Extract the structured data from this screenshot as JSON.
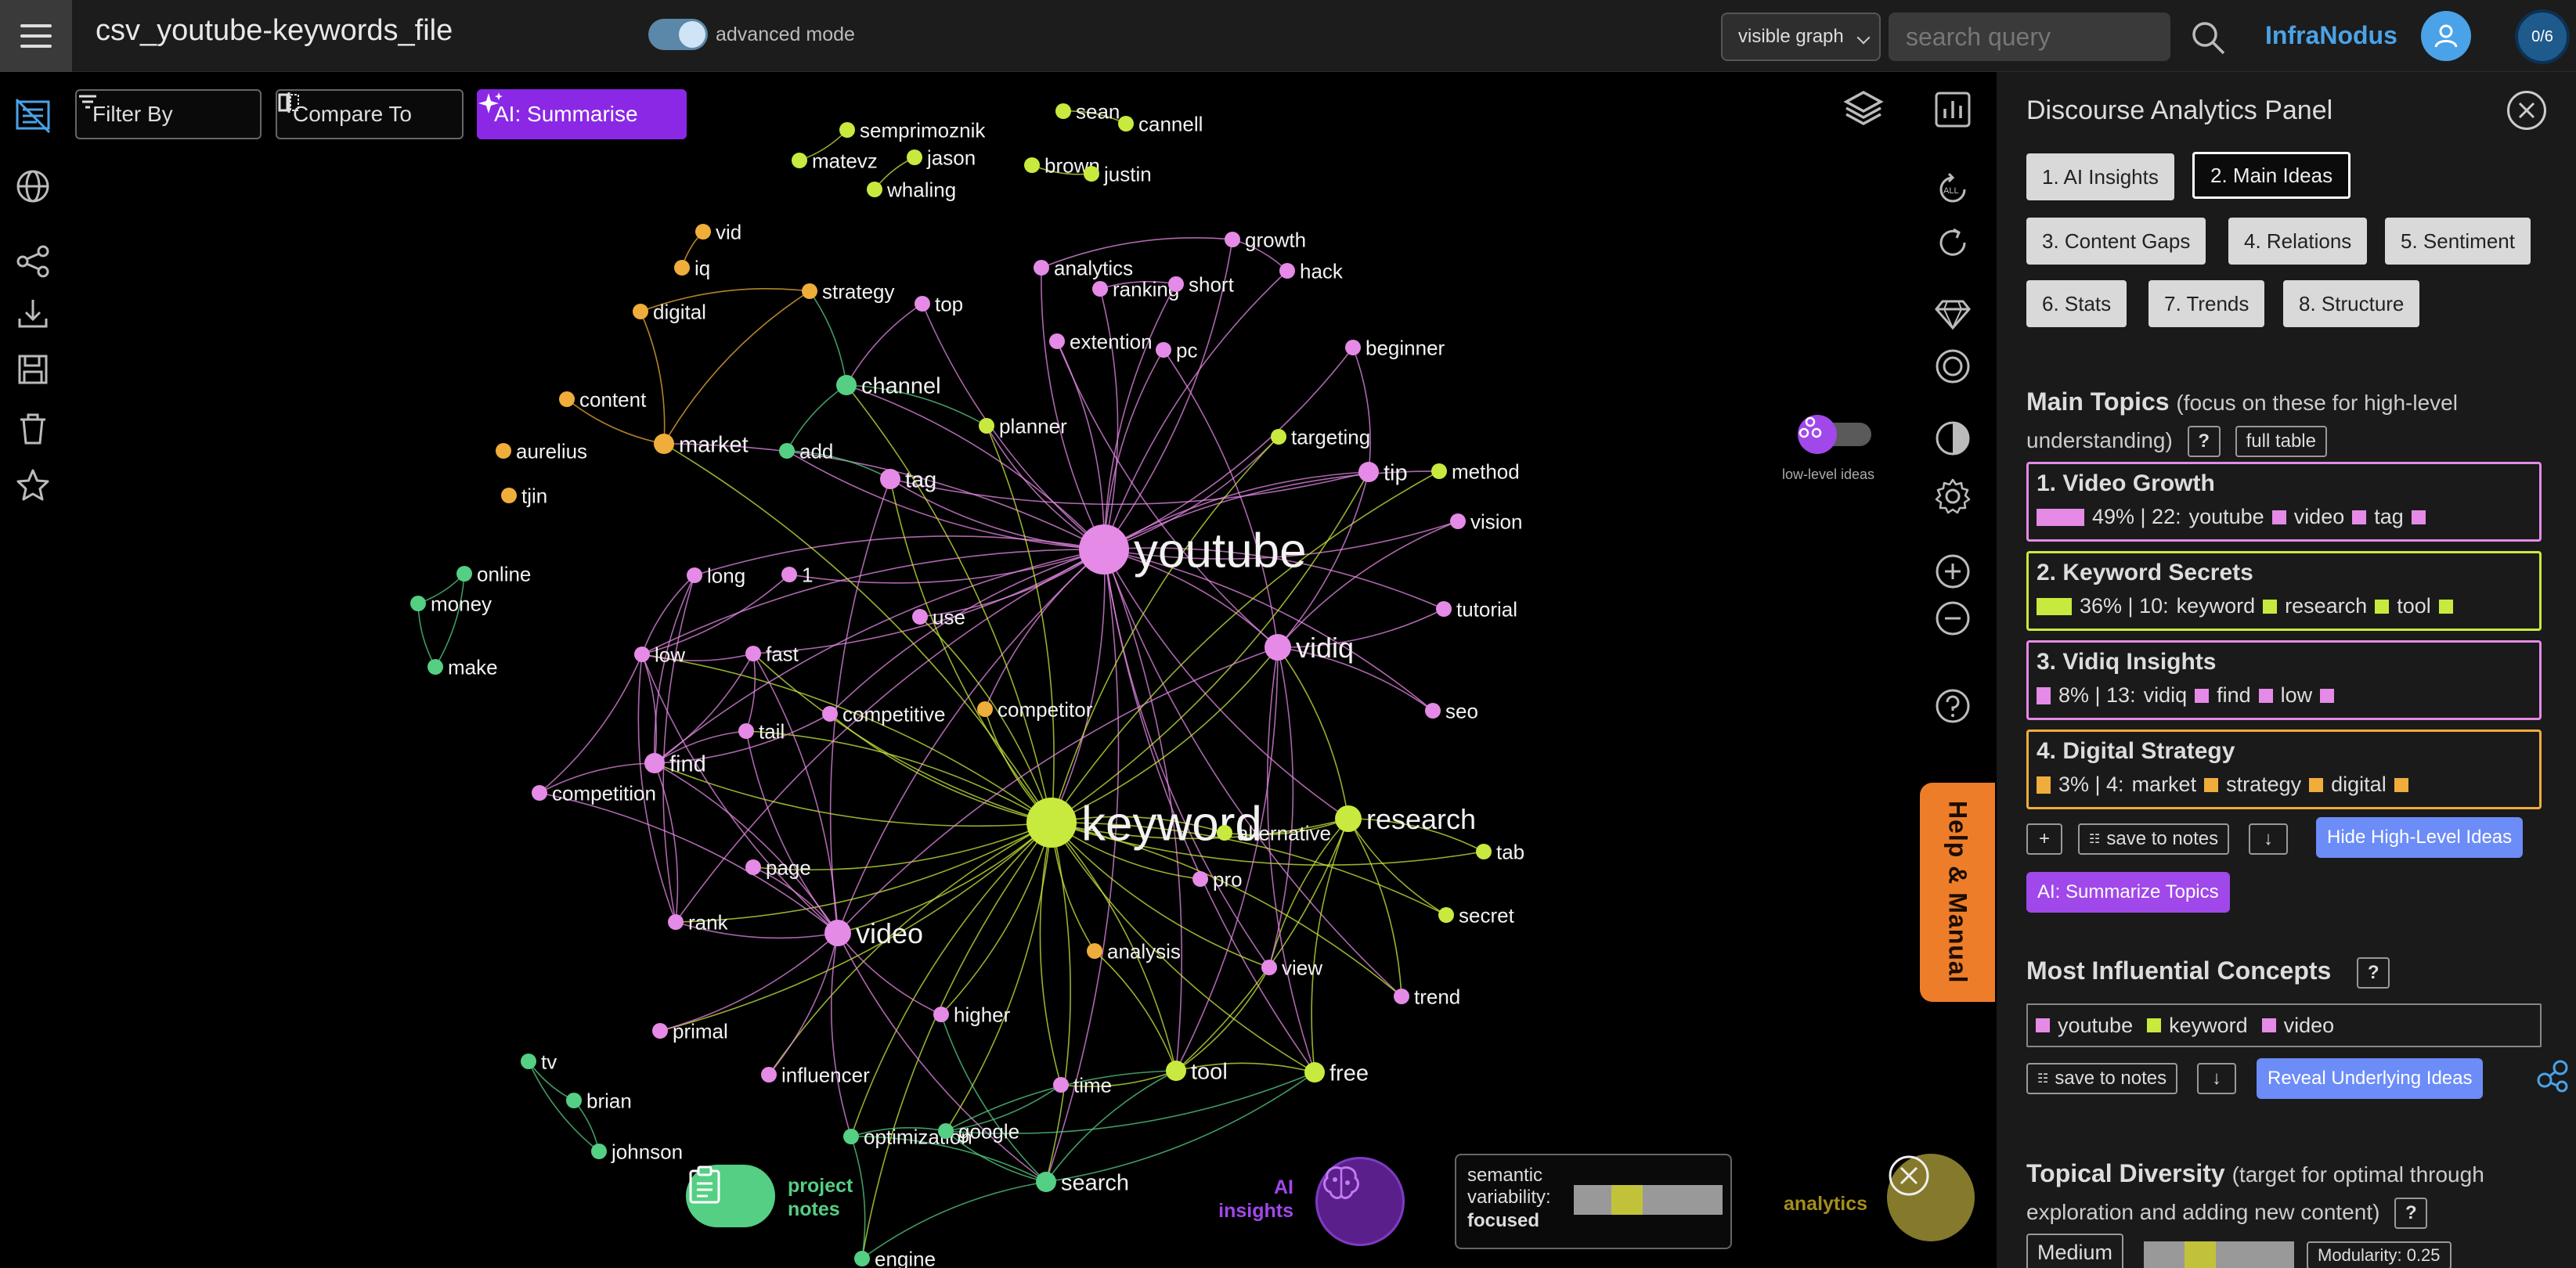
{
  "app": {
    "file_title": "csv_youtube-keywords_file",
    "advanced_mode_label": "advanced mode",
    "advanced_mode_on": true,
    "graph_select": "visible graph",
    "search_placeholder": "search query",
    "brand": "InfraNodus",
    "counter": "0/6"
  },
  "toolbar": {
    "filter_label": "Filter By",
    "compare_label": "Compare To",
    "ai_summarise_label": "AI: Summarise"
  },
  "graph": {
    "low_level_label": "low-level ideas",
    "colors": {
      "pink": "#e58ae6",
      "lime": "#c8ea3e",
      "green": "#55cf83",
      "orange": "#efad3b"
    },
    "nodes": [
      {
        "label": "youtube",
        "c": "pink",
        "s": 5
      },
      {
        "label": "keyword",
        "c": "lime",
        "s": 5
      },
      {
        "label": "video",
        "c": "pink",
        "s": 3
      },
      {
        "label": "vidiq",
        "c": "pink",
        "s": 3
      },
      {
        "label": "research",
        "c": "lime",
        "s": 3
      },
      {
        "label": "tool",
        "c": "lime",
        "s": 2
      },
      {
        "label": "free",
        "c": "lime",
        "s": 2
      },
      {
        "label": "search",
        "c": "green",
        "s": 2
      },
      {
        "label": "market",
        "c": "orange",
        "s": 2
      },
      {
        "label": "channel",
        "c": "green",
        "s": 2
      },
      {
        "label": "tag",
        "c": "pink",
        "s": 2
      },
      {
        "label": "find",
        "c": "pink",
        "s": 2
      },
      {
        "label": "tip",
        "c": "pink",
        "s": 2
      },
      {
        "label": "semprimoznik",
        "c": "lime",
        "s": 1
      },
      {
        "label": "sean",
        "c": "lime",
        "s": 1
      },
      {
        "label": "cannell",
        "c": "lime",
        "s": 1
      },
      {
        "label": "matevz",
        "c": "lime",
        "s": 1
      },
      {
        "label": "jason",
        "c": "lime",
        "s": 1
      },
      {
        "label": "brown",
        "c": "lime",
        "s": 1
      },
      {
        "label": "justin",
        "c": "lime",
        "s": 1
      },
      {
        "label": "whaling",
        "c": "lime",
        "s": 1
      },
      {
        "label": "vid",
        "c": "orange",
        "s": 1
      },
      {
        "label": "iq",
        "c": "orange",
        "s": 1
      },
      {
        "label": "digital",
        "c": "orange",
        "s": 1
      },
      {
        "label": "strategy",
        "c": "orange",
        "s": 1
      },
      {
        "label": "top",
        "c": "pink",
        "s": 1
      },
      {
        "label": "analytics",
        "c": "pink",
        "s": 1
      },
      {
        "label": "ranking",
        "c": "pink",
        "s": 1
      },
      {
        "label": "short",
        "c": "pink",
        "s": 1
      },
      {
        "label": "growth",
        "c": "pink",
        "s": 1
      },
      {
        "label": "hack",
        "c": "pink",
        "s": 1
      },
      {
        "label": "extention",
        "c": "pink",
        "s": 1
      },
      {
        "label": "pc",
        "c": "pink",
        "s": 1
      },
      {
        "label": "beginner",
        "c": "pink",
        "s": 1
      },
      {
        "label": "content",
        "c": "orange",
        "s": 1
      },
      {
        "label": "aurelius",
        "c": "orange",
        "s": 1
      },
      {
        "label": "tjin",
        "c": "orange",
        "s": 1
      },
      {
        "label": "add",
        "c": "green",
        "s": 1
      },
      {
        "label": "planner",
        "c": "lime",
        "s": 1
      },
      {
        "label": "targeting",
        "c": "lime",
        "s": 1
      },
      {
        "label": "method",
        "c": "lime",
        "s": 1
      },
      {
        "label": "vision",
        "c": "pink",
        "s": 1
      },
      {
        "label": "online",
        "c": "green",
        "s": 1
      },
      {
        "label": "money",
        "c": "green",
        "s": 1
      },
      {
        "label": "make",
        "c": "green",
        "s": 1
      },
      {
        "label": "long",
        "c": "pink",
        "s": 1
      },
      {
        "label": "1",
        "c": "pink",
        "s": 1
      },
      {
        "label": "use",
        "c": "pink",
        "s": 1
      },
      {
        "label": "tutorial",
        "c": "pink",
        "s": 1
      },
      {
        "label": "low",
        "c": "pink",
        "s": 1
      },
      {
        "label": "fast",
        "c": "pink",
        "s": 1
      },
      {
        "label": "competitive",
        "c": "pink",
        "s": 1
      },
      {
        "label": "competitor",
        "c": "orange",
        "s": 1
      },
      {
        "label": "tail",
        "c": "pink",
        "s": 1
      },
      {
        "label": "seo",
        "c": "pink",
        "s": 1
      },
      {
        "label": "competition",
        "c": "pink",
        "s": 1
      },
      {
        "label": "alternative",
        "c": "lime",
        "s": 1
      },
      {
        "label": "tab",
        "c": "lime",
        "s": 1
      },
      {
        "label": "page",
        "c": "pink",
        "s": 1
      },
      {
        "label": "pro",
        "c": "pink",
        "s": 1
      },
      {
        "label": "secret",
        "c": "lime",
        "s": 1
      },
      {
        "label": "rank",
        "c": "pink",
        "s": 1
      },
      {
        "label": "analysis",
        "c": "orange",
        "s": 1
      },
      {
        "label": "view",
        "c": "pink",
        "s": 1
      },
      {
        "label": "trend",
        "c": "pink",
        "s": 1
      },
      {
        "label": "higher",
        "c": "pink",
        "s": 1
      },
      {
        "label": "primal",
        "c": "pink",
        "s": 1
      },
      {
        "label": "influencer",
        "c": "pink",
        "s": 1
      },
      {
        "label": "time",
        "c": "pink",
        "s": 1
      },
      {
        "label": "tv",
        "c": "green",
        "s": 1
      },
      {
        "label": "brian",
        "c": "green",
        "s": 1
      },
      {
        "label": "johnson",
        "c": "green",
        "s": 1
      },
      {
        "label": "optimization",
        "c": "green",
        "s": 1
      },
      {
        "label": "google",
        "c": "green",
        "s": 1
      },
      {
        "label": "engine",
        "c": "green",
        "s": 1
      }
    ],
    "edges": [
      [
        "youtube",
        "keyword"
      ],
      [
        "youtube",
        "video"
      ],
      [
        "youtube",
        "vidiq"
      ],
      [
        "youtube",
        "research"
      ],
      [
        "youtube",
        "tool"
      ],
      [
        "youtube",
        "free"
      ],
      [
        "youtube",
        "tag"
      ],
      [
        "youtube",
        "channel"
      ],
      [
        "youtube",
        "analytics"
      ],
      [
        "youtube",
        "growth"
      ],
      [
        "youtube",
        "hack"
      ],
      [
        "youtube",
        "extention"
      ],
      [
        "youtube",
        "pc"
      ],
      [
        "youtube",
        "beginner"
      ],
      [
        "youtube",
        "short"
      ],
      [
        "youtube",
        "ranking"
      ],
      [
        "youtube",
        "planner"
      ],
      [
        "youtube",
        "targeting"
      ],
      [
        "youtube",
        "tip"
      ],
      [
        "youtube",
        "market"
      ],
      [
        "youtube",
        "seo"
      ],
      [
        "youtube",
        "find"
      ],
      [
        "youtube",
        "use"
      ],
      [
        "youtube",
        "competitive"
      ],
      [
        "youtube",
        "top"
      ],
      [
        "youtube",
        "rank"
      ],
      [
        "youtube",
        "search"
      ],
      [
        "youtube",
        "view"
      ],
      [
        "youtube",
        "tutorial"
      ],
      [
        "youtube",
        "vision"
      ],
      [
        "youtube",
        "method"
      ],
      [
        "youtube",
        "low"
      ],
      [
        "youtube",
        "fast"
      ],
      [
        "youtube",
        "long"
      ],
      [
        "youtube",
        "1"
      ],
      [
        "youtube",
        "competitor"
      ],
      [
        "youtube",
        "add"
      ],
      [
        "youtube",
        "trend"
      ],
      [
        "keyword",
        "video"
      ],
      [
        "keyword",
        "research"
      ],
      [
        "keyword",
        "tool"
      ],
      [
        "keyword",
        "free"
      ],
      [
        "keyword",
        "search"
      ],
      [
        "keyword",
        "vidiq"
      ],
      [
        "keyword",
        "find"
      ],
      [
        "keyword",
        "tail"
      ],
      [
        "keyword",
        "tag"
      ],
      [
        "keyword",
        "planner"
      ],
      [
        "keyword",
        "competitor"
      ],
      [
        "keyword",
        "analysis"
      ],
      [
        "keyword",
        "alternative"
      ],
      [
        "keyword",
        "pro"
      ],
      [
        "keyword",
        "google"
      ],
      [
        "keyword",
        "optimization"
      ],
      [
        "keyword",
        "rank"
      ],
      [
        "keyword",
        "view"
      ],
      [
        "keyword",
        "secret"
      ],
      [
        "keyword",
        "tab"
      ],
      [
        "keyword",
        "trend"
      ],
      [
        "keyword",
        "time"
      ],
      [
        "keyword",
        "higher"
      ],
      [
        "keyword",
        "channel"
      ],
      [
        "keyword",
        "targeting"
      ],
      [
        "keyword",
        "market"
      ],
      [
        "keyword",
        "competitive"
      ],
      [
        "keyword",
        "use"
      ],
      [
        "keyword",
        "page"
      ],
      [
        "keyword",
        "low"
      ],
      [
        "keyword",
        "fast"
      ],
      [
        "keyword",
        "influencer"
      ],
      [
        "keyword",
        "primal"
      ],
      [
        "keyword",
        "engine"
      ],
      [
        "keyword",
        "method"
      ],
      [
        "keyword",
        "tip"
      ],
      [
        "video",
        "rank"
      ],
      [
        "video",
        "find"
      ],
      [
        "video",
        "tag"
      ],
      [
        "video",
        "higher"
      ],
      [
        "video",
        "vidiq"
      ],
      [
        "video",
        "page"
      ],
      [
        "video",
        "tail"
      ],
      [
        "video",
        "competition"
      ],
      [
        "video",
        "low"
      ],
      [
        "video",
        "fast"
      ],
      [
        "video",
        "influencer"
      ],
      [
        "video",
        "optimization"
      ],
      [
        "video",
        "primal"
      ],
      [
        "video",
        "search"
      ],
      [
        "research",
        "tool"
      ],
      [
        "research",
        "free"
      ],
      [
        "research",
        "tab"
      ],
      [
        "research",
        "secret"
      ],
      [
        "research",
        "alternative"
      ],
      [
        "research",
        "vidiq"
      ],
      [
        "research",
        "trend"
      ],
      [
        "research",
        "view"
      ],
      [
        "vidiq",
        "tool"
      ],
      [
        "vidiq",
        "free"
      ],
      [
        "vidiq",
        "seo"
      ],
      [
        "vidiq",
        "tip"
      ],
      [
        "vidiq",
        "extention"
      ],
      [
        "vidiq",
        "pc"
      ],
      [
        "vidiq",
        "view"
      ],
      [
        "vidiq",
        "tutorial"
      ],
      [
        "vidiq",
        "vision"
      ],
      [
        "search",
        "engine"
      ],
      [
        "search",
        "google"
      ],
      [
        "search",
        "optimization"
      ],
      [
        "search",
        "tool"
      ],
      [
        "search",
        "free"
      ],
      [
        "search",
        "higher"
      ],
      [
        "google",
        "optimization"
      ],
      [
        "google",
        "tool"
      ],
      [
        "google",
        "free"
      ],
      [
        "optimization",
        "engine"
      ],
      [
        "google",
        "time"
      ],
      [
        "tool",
        "free"
      ],
      [
        "tool",
        "view"
      ],
      [
        "tool",
        "time"
      ],
      [
        "tool",
        "analysis"
      ],
      [
        "market",
        "strategy"
      ],
      [
        "market",
        "digital"
      ],
      [
        "digital",
        "strategy"
      ],
      [
        "vid",
        "iq"
      ],
      [
        "market",
        "content"
      ],
      [
        "channel",
        "add"
      ],
      [
        "channel",
        "planner"
      ],
      [
        "channel",
        "strategy"
      ],
      [
        "add",
        "tag"
      ],
      [
        "tag",
        "tip"
      ],
      [
        "online",
        "money"
      ],
      [
        "money",
        "make"
      ],
      [
        "online",
        "make"
      ],
      [
        "tv",
        "brian"
      ],
      [
        "brian",
        "johnson"
      ],
      [
        "tv",
        "johnson"
      ],
      [
        "sean",
        "cannell"
      ],
      [
        "brown",
        "justin"
      ],
      [
        "semprimoznik",
        "matevz"
      ],
      [
        "jason",
        "whaling"
      ],
      [
        "low",
        "competition"
      ],
      [
        "low",
        "fast"
      ],
      [
        "find",
        "rank"
      ],
      [
        "find",
        "low"
      ],
      [
        "find",
        "tail"
      ],
      [
        "find",
        "competition"
      ],
      [
        "find",
        "long"
      ],
      [
        "find",
        "competitive"
      ],
      [
        "fast",
        "tail"
      ],
      [
        "long",
        "low"
      ],
      [
        "1",
        "low"
      ],
      [
        "find",
        "fast"
      ],
      [
        "rank",
        "long"
      ],
      [
        "low",
        "rank"
      ],
      [
        "analytics",
        "growth"
      ],
      [
        "hack",
        "growth"
      ],
      [
        "ranking",
        "short"
      ],
      [
        "top",
        "channel"
      ],
      [
        "beginner",
        "tip"
      ]
    ]
  },
  "bottom": {
    "project_notes_label": "project notes",
    "ai_insights_label": "AI insights",
    "semantic_variability_label": "semantic variability:",
    "semantic_variability_value": "focused",
    "analytics_label": "analytics"
  },
  "panel": {
    "title": "Discourse Analytics Panel",
    "tabs": [
      "1. AI Insights",
      "2. Main Ideas",
      "3. Content Gaps",
      "4. Relations",
      "5. Sentiment",
      "6. Stats",
      "7. Trends",
      "8. Structure"
    ],
    "active_tab": 1,
    "main_topics_title": "Main Topics",
    "main_topics_sub": "(focus on these for high-level understanding)",
    "full_table": "full table",
    "topics": [
      {
        "name": "1. Video Growth",
        "color": "#e58ae6",
        "pct": 49,
        "pct_label": "49%",
        "count_label": "22:",
        "words": [
          "youtube",
          "video",
          "tag"
        ]
      },
      {
        "name": "2. Keyword Secrets",
        "color": "#c8ea3e",
        "pct": 36,
        "pct_label": "36%",
        "count_label": "10:",
        "words": [
          "keyword",
          "research",
          "tool"
        ]
      },
      {
        "name": "3. Vidiq Insights",
        "color": "#e58ae6",
        "pct": 8,
        "pct_label": "8%",
        "count_label": "13:",
        "words": [
          "vidiq",
          "find",
          "low"
        ]
      },
      {
        "name": "4. Digital Strategy",
        "color": "#efad3b",
        "pct": 3,
        "pct_label": "3%",
        "count_label": "4:",
        "words": [
          "market",
          "strategy",
          "digital"
        ]
      }
    ],
    "plus_label": "+",
    "save_to_notes": "save to notes",
    "download": "↓",
    "hide_high_level": "Hide High-Level Ideas",
    "ai_summarize_topics": "AI: Summarize Topics",
    "influential_title": "Most Influential Concepts",
    "question_mark": "?",
    "influential": [
      {
        "word": "youtube",
        "color": "#e58ae6"
      },
      {
        "word": "keyword",
        "color": "#c8ea3e"
      },
      {
        "word": "video",
        "color": "#e58ae6"
      }
    ],
    "reveal_underlying": "Reveal Underlying Ideas",
    "diversity_title": "Topical Diversity",
    "diversity_sub": "(target for optimal through exploration and adding new content)",
    "diversity_level": "Medium",
    "modularity": "Modularity: 0.25",
    "help_manual": "Help & Manual"
  }
}
